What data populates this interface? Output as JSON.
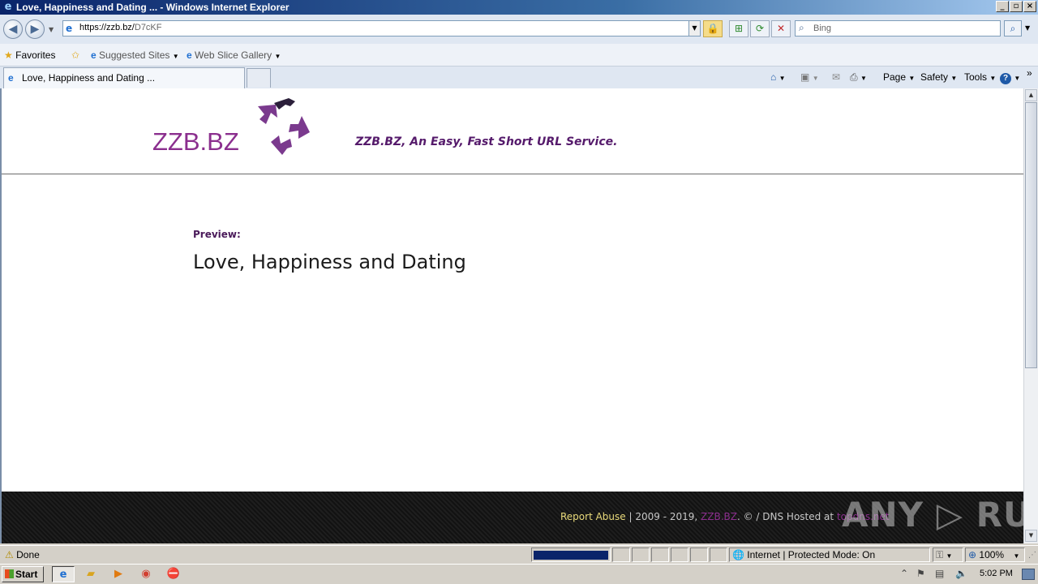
{
  "window": {
    "title": "Love, Happiness and Dating ... - Windows Internet Explorer",
    "ie_icon": "ie-icon",
    "minimize": "_",
    "maximize": "▫",
    "close": "×"
  },
  "address": {
    "url_host": "https://zzb.bz/",
    "url_path": "D7cKF",
    "search_placeholder": "Bing"
  },
  "favorites_bar": {
    "favorites_label": "Favorites",
    "suggested_sites": "Suggested Sites",
    "web_slice_gallery": "Web Slice Gallery"
  },
  "tabs": {
    "active_label": "Love, Happiness and Dating ..."
  },
  "command_bar": {
    "page": "Page",
    "safety": "Safety",
    "tools": "Tools",
    "more": "»"
  },
  "page": {
    "logo_text": "ZZB.BZ",
    "tagline": "ZZB.BZ, An Easy, Fast Short URL Service.",
    "preview_label": "Preview:",
    "preview_title": "Love, Happiness and Dating",
    "footer": {
      "report_abuse": "Report Abuse",
      "years": " | 2009 - 2019, ",
      "brand": "ZZB.BZ",
      "copyright": ". © / DNS Hosted at ",
      "host": "topdns.net"
    },
    "watermark": "ANY ▷ RUN"
  },
  "status_bar": {
    "status_text": "Done",
    "zone_text": "Internet | Protected Mode: On",
    "zoom": "100%"
  },
  "taskbar": {
    "start_label": "Start",
    "clock": "5:02 PM"
  },
  "colors": {
    "brand_purple": "#8b2f8e",
    "tagline_purple": "#551a6b",
    "footer_bg": "#161616"
  }
}
